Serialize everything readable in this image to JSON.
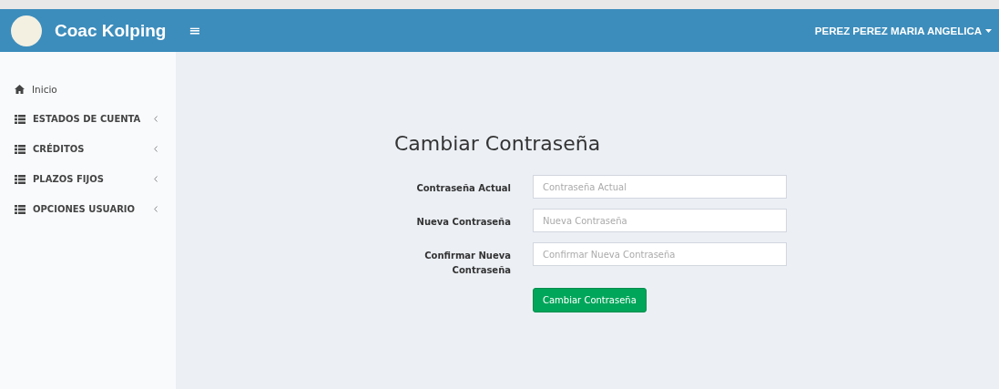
{
  "header": {
    "brand": "Coac Kolping",
    "menu_toggle": "≡",
    "user": "PEREZ PEREZ MARIA ANGELICA"
  },
  "sidebar": {
    "items": [
      {
        "label": "Inicio",
        "kind": "home",
        "expandable": false
      },
      {
        "label": "ESTADOS DE CUENTA",
        "kind": "list",
        "expandable": true
      },
      {
        "label": "CRÉDITOS",
        "kind": "list",
        "expandable": true
      },
      {
        "label": "PLAZOS FIJOS",
        "kind": "list",
        "expandable": true
      },
      {
        "label": "OPCIONES USUARIO",
        "kind": "list",
        "expandable": true
      }
    ]
  },
  "form": {
    "title": "Cambiar Contraseña",
    "fields": [
      {
        "label": "Contraseña Actual",
        "placeholder": "Contraseña Actual"
      },
      {
        "label": "Nueva Contraseña",
        "placeholder": "Nueva Contraseña"
      },
      {
        "label": "Confirmar Nueva Contraseña",
        "placeholder": "Confirmar Nueva Contraseña"
      }
    ],
    "submit": "Cambiar Contraseña"
  }
}
